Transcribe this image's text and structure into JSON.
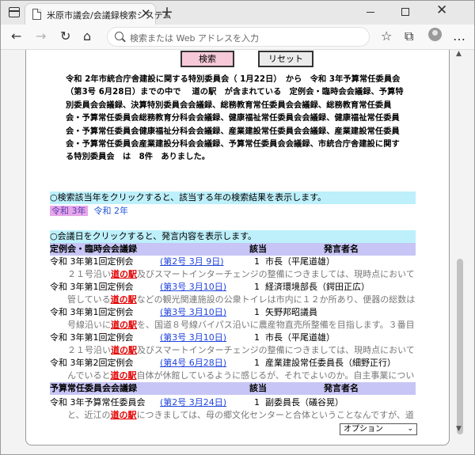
{
  "browser": {
    "tab_title": "米原市議会/会議録検索システム",
    "tab_close_glyph": "✕",
    "new_tab_glyph": "+",
    "address_placeholder": "検索または Web アドレスを入力",
    "window_close_glyph": "✕",
    "toolbar_glyphs": {
      "back": "←",
      "forward": "→",
      "refresh": "↻",
      "home": "⌂",
      "favorite": "☆",
      "favorites": "✩",
      "collections": "⧉",
      "more": "…"
    }
  },
  "buttons": {
    "search_label": "検索",
    "reset_label": "リセット"
  },
  "summary": {
    "text": "令和 2年市統合庁舎建設に関する特別委員会（ 1月22日）　から　令和 3年予算常任委員会（第3号 6月28日）までの中で　 道の駅　が含まれている　定例会・臨時会会議録、予算特別委員会会議録、決算特別委員会会議録、総務教育常任委員会会議録、総務教育常任委員会・予算常任委員会総務教育分科会会議録、健康福祉常任委員会会議録、健康福祉常任委員会・予算常任委員会健康福祉分科会会議録、産業建設常任委員会会議録、産業建設常任委員会・予算常任委員会産業建設分科会会議録、予算常任委員会会議録、市統合庁舎建設に関する特別委員会　は　8件　ありました。"
  },
  "year_section": {
    "header": "○検索該当年をクリックすると、該当する年の検索結果を表示します。",
    "years": [
      "令和 3年",
      "令和 2年"
    ]
  },
  "meeting_section": {
    "header": "○会議日をクリックすると、発言内容を表示します。",
    "groups": [
      {
        "columns": {
          "meeting": "定例会・臨時会会議録",
          "date": "該当",
          "speaker": "発言者名"
        },
        "rows": [
          {
            "meeting": "令和 3年第1回定例会",
            "date": "(第2号 3月 9日)",
            "num": "1",
            "speaker": "市長（平尾道雄）",
            "snippet_pre": "２１号沿い",
            "snippet_hl": "道の駅",
            "snippet_post": "及びスマートインターチェンジの整備につきましては、現時点において"
          },
          {
            "meeting": "令和 3年第1回定例会",
            "date": "(第3号 3月10日)",
            "num": "1",
            "speaker": "経済環境部長（鍔田正広）",
            "snippet_pre": "管している",
            "snippet_hl": "道の駅",
            "snippet_post": "などの観光関連施設の公衆トイレは市内に１２か所あり、便器の総数は"
          },
          {
            "meeting": "令和 3年第1回定例会",
            "date": "(第3号 3月10日)",
            "num": "1",
            "speaker": "矢野邦昭議員",
            "snippet_pre": "号線沿いに",
            "snippet_hl": "道の駅",
            "snippet_post": "を、国道８号線バイパス沿いに農産物直売所整備を目指します。３番目"
          },
          {
            "meeting": "令和 3年第1回定例会",
            "date": "(第3号 3月10日)",
            "num": "1",
            "speaker": "市長（平尾道雄）",
            "snippet_pre": "２１号沿い",
            "snippet_hl": "道の駅",
            "snippet_post": "及びスマートインターチェンジの整備につきましては、現時点において"
          },
          {
            "meeting": "令和 3年第2回定例会",
            "date": "(第4号 6月28日)",
            "num": "1",
            "speaker": "産業建設常任委員長（細野正行）",
            "snippet_pre": "んでいると",
            "snippet_hl": "道の駅",
            "snippet_post": "自体が休館しているように感じるが、それでよいのか。自主事業につい"
          }
        ]
      },
      {
        "columns": {
          "meeting": "予算常任委員会会議録",
          "date": "該当",
          "speaker": "発言者名"
        },
        "rows": [
          {
            "meeting": "令和 3年予算常任委員会",
            "date": "(第2号 3月24日)",
            "num": "1",
            "speaker": "副委員長（礒谷晃）",
            "snippet_pre": "と、近江の",
            "snippet_hl": "道の駅",
            "snippet_post": "につきましては、母の郷文化センターと合体ということなんですが、道"
          }
        ]
      }
    ]
  },
  "options_select": {
    "selected": "オプション",
    "caret": "⌄"
  },
  "scrollbar": {
    "up": "▲",
    "down": "▼"
  }
}
